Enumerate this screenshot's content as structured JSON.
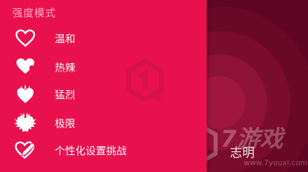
{
  "panel": {
    "title": "强度模式",
    "items": [
      {
        "label": "温和",
        "icon": "heart-outline-icon"
      },
      {
        "label": "热辣",
        "icon": "heart-drip-icon"
      },
      {
        "label": "猛烈",
        "icon": "heart-flame-icon"
      },
      {
        "label": "极限",
        "icon": "heart-spiked-icon"
      },
      {
        "label": "个性化设置挑战",
        "icon": "heart-pencil-icon"
      }
    ]
  },
  "background": {
    "brand_text": "7游戏",
    "site_text": "www.7youxi.com",
    "bottom_label": "志明"
  },
  "colors": {
    "panel": "#e8114e",
    "background": "#6f0826",
    "text": "#ffffff"
  }
}
